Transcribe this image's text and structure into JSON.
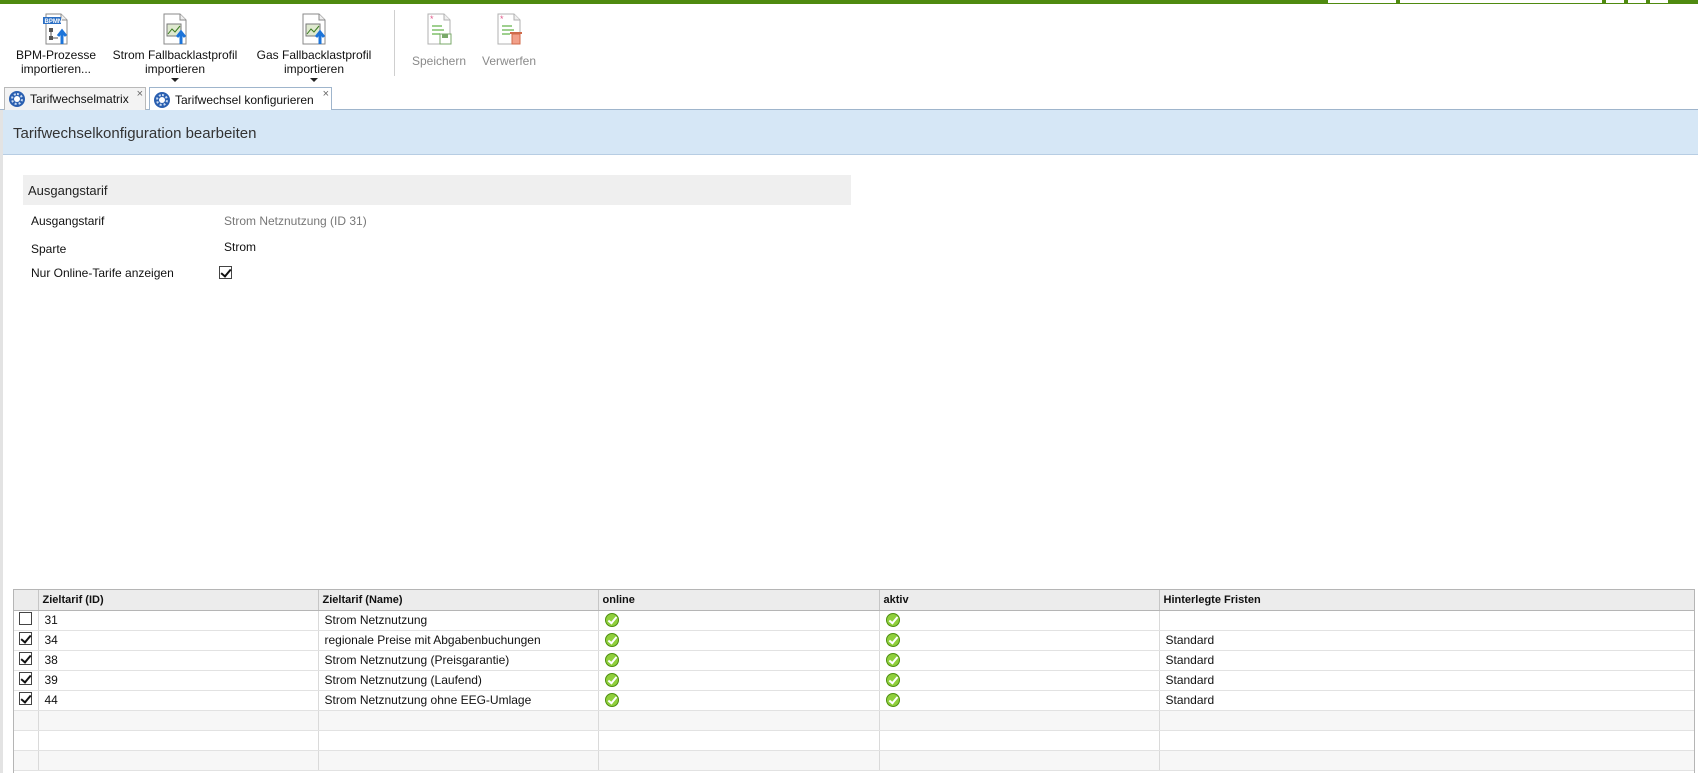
{
  "toolbar": {
    "buttons": [
      {
        "label": "BPM-Prozesse importieren...",
        "icon": "bpm-import-icon"
      },
      {
        "label": "Strom Fallbacklastprofil importieren",
        "icon": "chart-import-icon"
      },
      {
        "label": "Gas Fallbacklastprofil importieren",
        "icon": "chart-import-icon"
      },
      {
        "label": "Speichern",
        "icon": "save-document-icon"
      },
      {
        "label": "Verwerfen",
        "icon": "discard-document-icon"
      }
    ]
  },
  "tabs": [
    {
      "label": "Tarifwechselmatrix",
      "icon": "gear-icon"
    },
    {
      "label": "Tarifwechsel konfigurieren",
      "icon": "gear-icon"
    }
  ],
  "page": {
    "title": "Tarifwechselkonfiguration bearbeiten"
  },
  "form": {
    "section_title": "Ausgangstarif",
    "fields": [
      {
        "label": "Ausgangstarif",
        "value": "Strom Netznutzung (ID 31)"
      },
      {
        "label": "Sparte",
        "value": "Strom"
      },
      {
        "label": "Nur Online-Tarife anzeigen",
        "checked": true
      }
    ]
  },
  "grid": {
    "columns": [
      "Zieltarif (ID)",
      "Zieltarif (Name)",
      "online",
      "aktiv",
      "Hinterlegte Fristen"
    ],
    "rows": [
      {
        "checked": false,
        "id": "31",
        "name": "Strom Netznutzung",
        "online": true,
        "aktiv": true,
        "fristen": ""
      },
      {
        "checked": true,
        "id": "34",
        "name": "regionale Preise mit Abgabenbuchungen",
        "online": true,
        "aktiv": true,
        "fristen": "Standard"
      },
      {
        "checked": true,
        "id": "38",
        "name": "Strom Netznutzung (Preisgarantie)",
        "online": true,
        "aktiv": true,
        "fristen": "Standard"
      },
      {
        "checked": true,
        "id": "39",
        "name": "Strom Netznutzung (Laufend)",
        "online": true,
        "aktiv": true,
        "fristen": "Standard"
      },
      {
        "checked": true,
        "id": "44",
        "name": "Strom Netznutzung ohne EEG-Umlage",
        "online": true,
        "aktiv": true,
        "fristen": "Standard"
      }
    ]
  },
  "colors": {
    "accent_bar": "#4f8a10",
    "header_band": "#d6e7f6",
    "ok_icon": "#8fcf3c"
  }
}
